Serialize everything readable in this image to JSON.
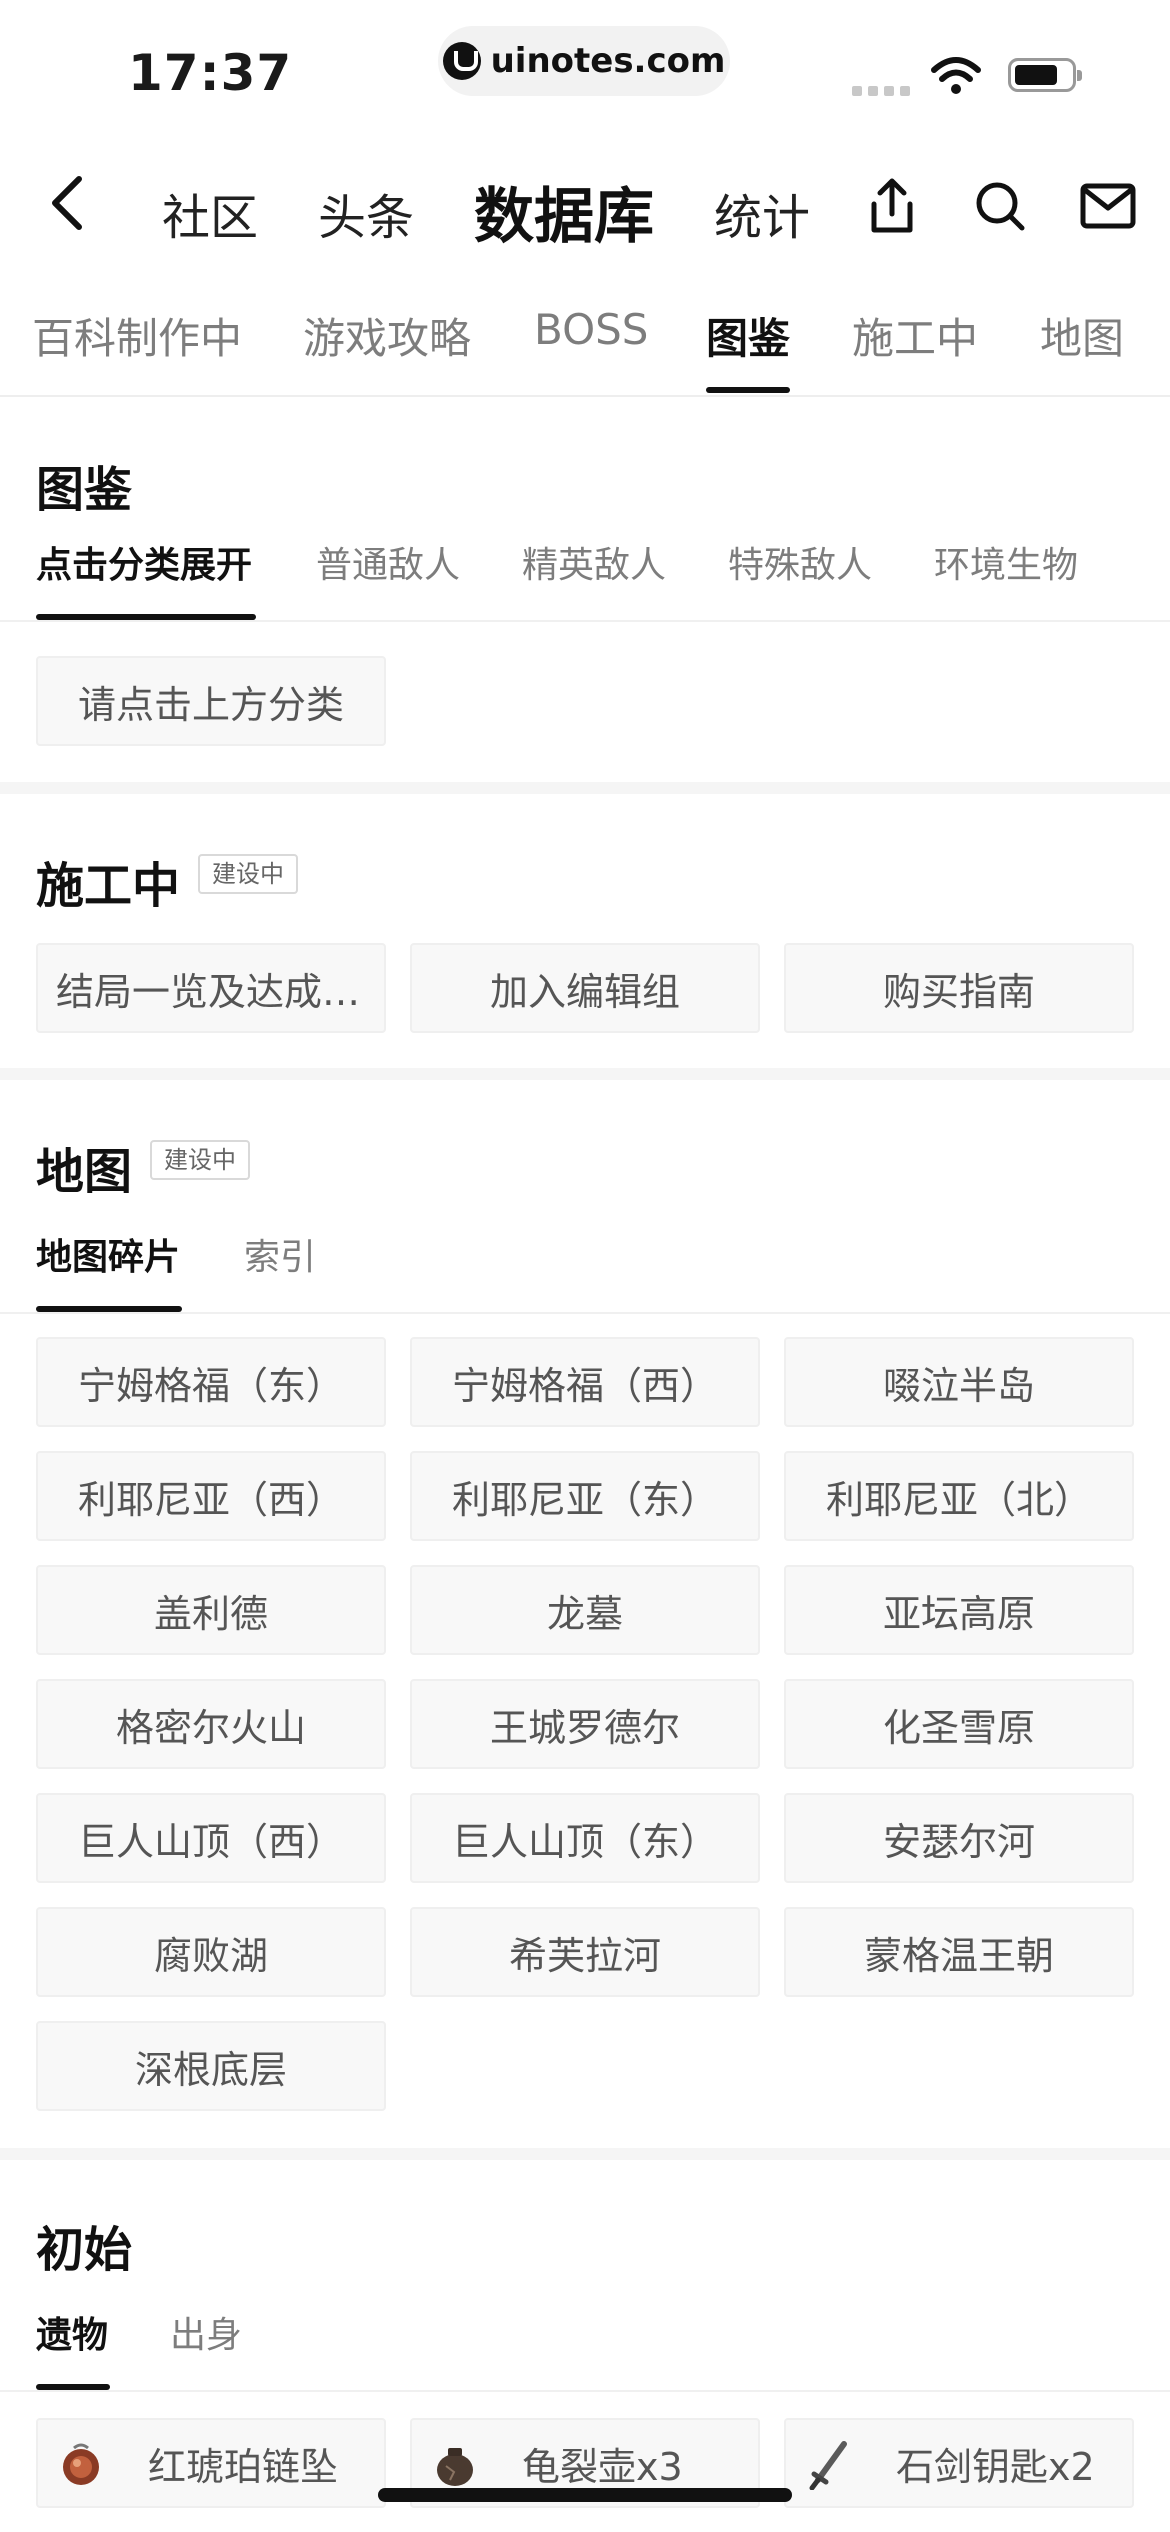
{
  "status": {
    "time": "17:37",
    "url": "uinotes.com"
  },
  "topnav": {
    "items": [
      "社区",
      "头条",
      "数据库",
      "统计"
    ],
    "active_index": 2
  },
  "category_tabs": [
    "百科制作中",
    "游戏攻略",
    "BOSS",
    "图鉴",
    "施工中",
    "地图"
  ],
  "category_active": "图鉴",
  "section_tujian": {
    "title": "图鉴",
    "tabs": [
      "点击分类展开",
      "普通敌人",
      "精英敌人",
      "特殊敌人",
      "环境生物"
    ],
    "placeholder": "请点击上方分类"
  },
  "section_construction": {
    "title": "施工中",
    "badge": "建设中",
    "items": [
      "结局一览及达成条件",
      "加入编辑组",
      "购买指南"
    ]
  },
  "section_map": {
    "title": "地图",
    "badge": "建设中",
    "tabs": [
      "地图碎片",
      "索引"
    ],
    "items": [
      "宁姆格福（东）",
      "宁姆格福（西）",
      "啜泣半岛",
      "利耶尼亚（西）",
      "利耶尼亚（东）",
      "利耶尼亚（北）",
      "盖利德",
      "龙墓",
      "亚坛高原",
      "格密尔火山",
      "王城罗德尔",
      "化圣雪原",
      "巨人山顶（西）",
      "巨人山顶（东）",
      "安瑟尔河",
      "腐败湖",
      "希芙拉河",
      "蒙格温王朝",
      "深根底层"
    ]
  },
  "section_start": {
    "title": "初始",
    "tabs": [
      "遗物",
      "出身"
    ],
    "items": [
      {
        "label": "红琥珀链坠",
        "icon": "amber-pendant-icon"
      },
      {
        "label": "龟裂壶x3",
        "icon": "cracked-pot-icon"
      },
      {
        "label": "石剑钥匙x2",
        "icon": "stonesword-key-icon"
      }
    ]
  }
}
